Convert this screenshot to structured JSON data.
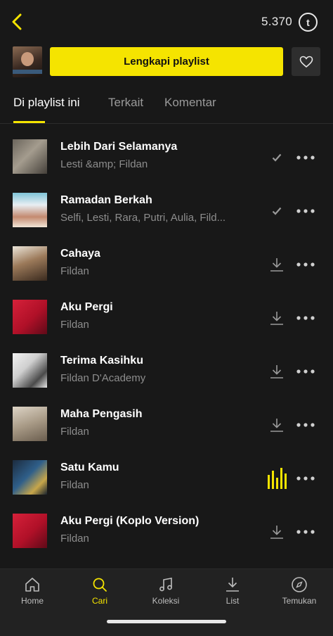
{
  "header": {
    "coins": "5.370",
    "coin_icon_letter": "t"
  },
  "playlist_cta": {
    "label": "Lengkapi playlist"
  },
  "tabs": [
    {
      "label": "Di playlist ini"
    },
    {
      "label": "Terkait"
    },
    {
      "label": "Komentar"
    }
  ],
  "songs": [
    {
      "title": "Lebih Dari Selamanya",
      "artist": "Lesti &amp; Fildan",
      "status": "downloaded"
    },
    {
      "title": "Ramadan Berkah",
      "artist": "Selfi, Lesti, Rara, Putri, Aulia, Fild...",
      "status": "downloaded"
    },
    {
      "title": "Cahaya",
      "artist": "Fildan",
      "status": "download"
    },
    {
      "title": "Aku Pergi",
      "artist": "Fildan",
      "status": "download"
    },
    {
      "title": "Terima Kasihku",
      "artist": "Fildan D'Academy",
      "status": "download"
    },
    {
      "title": "Maha Pengasih",
      "artist": "Fildan",
      "status": "download"
    },
    {
      "title": "Satu Kamu",
      "artist": "Fildan",
      "status": "playing"
    },
    {
      "title": "Aku Pergi (Koplo Version)",
      "artist": "Fildan",
      "status": "download"
    }
  ],
  "nav": [
    {
      "label": "Home",
      "icon": "home-icon"
    },
    {
      "label": "Cari",
      "icon": "search-icon"
    },
    {
      "label": "Koleksi",
      "icon": "music-note-icon"
    },
    {
      "label": "List",
      "icon": "download-list-icon"
    },
    {
      "label": "Temukan",
      "icon": "compass-icon"
    }
  ],
  "colors": {
    "accent": "#f5e400",
    "background": "#181818",
    "nav_bg": "#222222"
  }
}
